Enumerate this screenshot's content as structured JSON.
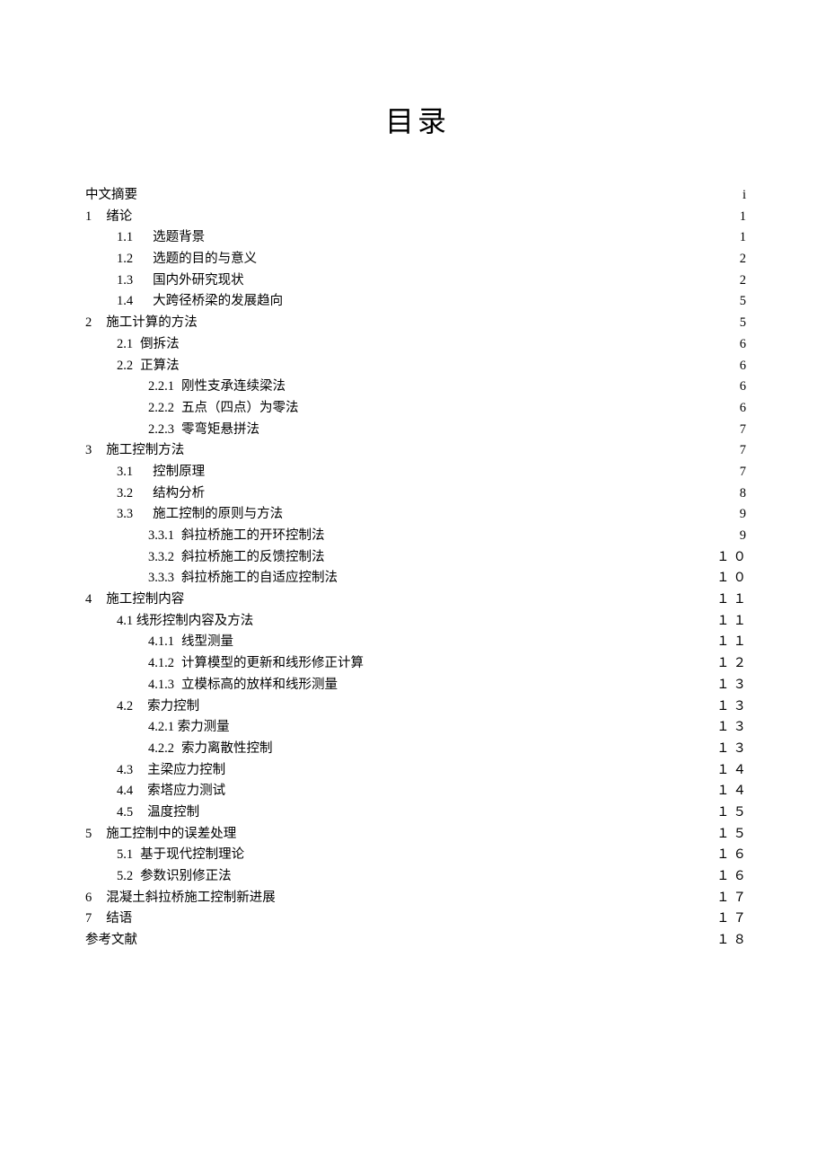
{
  "title": "目录",
  "toc": [
    {
      "level": 0,
      "num": "",
      "label": "中文摘要",
      "page": "i",
      "numgap": ""
    },
    {
      "level": 0,
      "num": "1",
      "label": "绪论",
      "page": "1",
      "numgap": "md"
    },
    {
      "level": 1,
      "num": "1.1",
      "label": "选题背景",
      "page": "1",
      "numgap": "lg"
    },
    {
      "level": 1,
      "num": "1.2",
      "label": "选题的目的与意义",
      "page": "2",
      "numgap": "lg"
    },
    {
      "level": 1,
      "num": "1.3",
      "label": "国内外研究现状",
      "page": "2",
      "numgap": "lg"
    },
    {
      "level": 1,
      "num": "1.4",
      "label": "大跨径桥梁的发展趋向",
      "page": "5",
      "numgap": "lg"
    },
    {
      "level": 0,
      "num": "2",
      "label": "施工计算的方法",
      "page": "5",
      "numgap": "md"
    },
    {
      "level": 1,
      "num": "2.1",
      "label": "倒拆法",
      "page": "6",
      "numgap": "sm"
    },
    {
      "level": 1,
      "num": "2.2",
      "label": "正算法",
      "page": "6",
      "numgap": "sm"
    },
    {
      "level": 2,
      "num": "2.2.1",
      "label": "刚性支承连续梁法",
      "page": "6",
      "numgap": "sm"
    },
    {
      "level": 2,
      "num": "2.2.2",
      "label": "五点（四点）为零法",
      "page": "6",
      "numgap": "sm"
    },
    {
      "level": 2,
      "num": "2.2.3",
      "label": "零弯矩悬拼法",
      "page": "7",
      "numgap": "sm"
    },
    {
      "level": 0,
      "num": "3",
      "label": "施工控制方法",
      "page": "7",
      "numgap": "md"
    },
    {
      "level": 1,
      "num": "3.1",
      "label": "控制原理",
      "page": "7",
      "numgap": "lg"
    },
    {
      "level": 1,
      "num": "3.2",
      "label": "结构分析",
      "page": "8",
      "numgap": "lg"
    },
    {
      "level": 1,
      "num": "3.3",
      "label": "施工控制的原则与方法",
      "page": "9",
      "numgap": "lg"
    },
    {
      "level": 2,
      "num": "3.3.1",
      "label": "斜拉桥施工的开环控制法",
      "page": "9",
      "numgap": "sm"
    },
    {
      "level": 2,
      "num": "3.3.2",
      "label": "斜拉桥施工的反馈控制法",
      "page": "１０",
      "numgap": "sm"
    },
    {
      "level": 2,
      "num": "3.3.3",
      "label": "斜拉桥施工的自适应控制法",
      "page": "１０",
      "numgap": "sm"
    },
    {
      "level": 0,
      "num": "4",
      "label": "施工控制内容",
      "page": "１１",
      "numgap": "md"
    },
    {
      "level": 1,
      "num": "4.1",
      "label": "线形控制内容及方法",
      "page": "１１",
      "numgap": ""
    },
    {
      "level": 2,
      "num": "4.1.1",
      "label": "线型测量",
      "page": "１１",
      "numgap": "sm"
    },
    {
      "level": 2,
      "num": "4.1.2",
      "label": "计算模型的更新和线形修正计算",
      "page": "１２",
      "numgap": "sm"
    },
    {
      "level": 2,
      "num": "4.1.3",
      "label": "立模标高的放样和线形测量",
      "page": "１３",
      "numgap": "sm"
    },
    {
      "level": 1,
      "num": "4.2",
      "label": "索力控制",
      "page": "１３",
      "numgap": "md"
    },
    {
      "level": 2,
      "num": "4.2.1",
      "label": "索力测量",
      "page": "１３",
      "numgap": ""
    },
    {
      "level": 2,
      "num": "4.2.2",
      "label": "索力离散性控制",
      "page": "１３",
      "numgap": "sm"
    },
    {
      "level": 1,
      "num": "4.3",
      "label": "主梁应力控制",
      "page": "１４",
      "numgap": "md"
    },
    {
      "level": 1,
      "num": "4.4",
      "label": "索塔应力测试",
      "page": "１４",
      "numgap": "md"
    },
    {
      "level": 1,
      "num": "4.5",
      "label": "温度控制",
      "page": "１５",
      "numgap": "md"
    },
    {
      "level": 0,
      "num": "5",
      "label": "施工控制中的误差处理",
      "page": "１５",
      "numgap": "md"
    },
    {
      "level": 1,
      "num": "5.1",
      "label": "基于现代控制理论",
      "page": "１６",
      "numgap": "sm"
    },
    {
      "level": 1,
      "num": "5.2",
      "label": "参数识别修正法",
      "page": "１６",
      "numgap": "sm"
    },
    {
      "level": 0,
      "num": "6",
      "label": "混凝土斜拉桥施工控制新进展",
      "page": "１７",
      "numgap": "md"
    },
    {
      "level": 0,
      "num": "7",
      "label": "结语",
      "page": "１７",
      "numgap": "md"
    },
    {
      "level": 0,
      "num": "",
      "label": "参考文献",
      "page": "１８",
      "numgap": ""
    }
  ]
}
